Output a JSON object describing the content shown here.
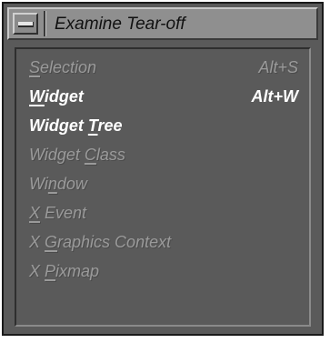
{
  "window": {
    "title": "Examine Tear-off"
  },
  "menu": {
    "items": [
      {
        "label_pre": "",
        "mnemonic": "S",
        "label_post": "election",
        "accel": "Alt+S",
        "enabled": false
      },
      {
        "label_pre": "",
        "mnemonic": "W",
        "label_post": "idget",
        "accel": "Alt+W",
        "enabled": true
      },
      {
        "label_pre": "Widget ",
        "mnemonic": "T",
        "label_post": "ree",
        "accel": "",
        "enabled": true
      },
      {
        "label_pre": "Widget ",
        "mnemonic": "C",
        "label_post": "lass",
        "accel": "",
        "enabled": false
      },
      {
        "label_pre": "Wi",
        "mnemonic": "n",
        "label_post": "dow",
        "accel": "",
        "enabled": false
      },
      {
        "label_pre": "",
        "mnemonic": "X",
        "label_post": " Event",
        "accel": "",
        "enabled": false
      },
      {
        "label_pre": "X ",
        "mnemonic": "G",
        "label_post": "raphics Context",
        "accel": "",
        "enabled": false
      },
      {
        "label_pre": "X ",
        "mnemonic": "P",
        "label_post": "ixmap",
        "accel": "",
        "enabled": false
      }
    ]
  }
}
